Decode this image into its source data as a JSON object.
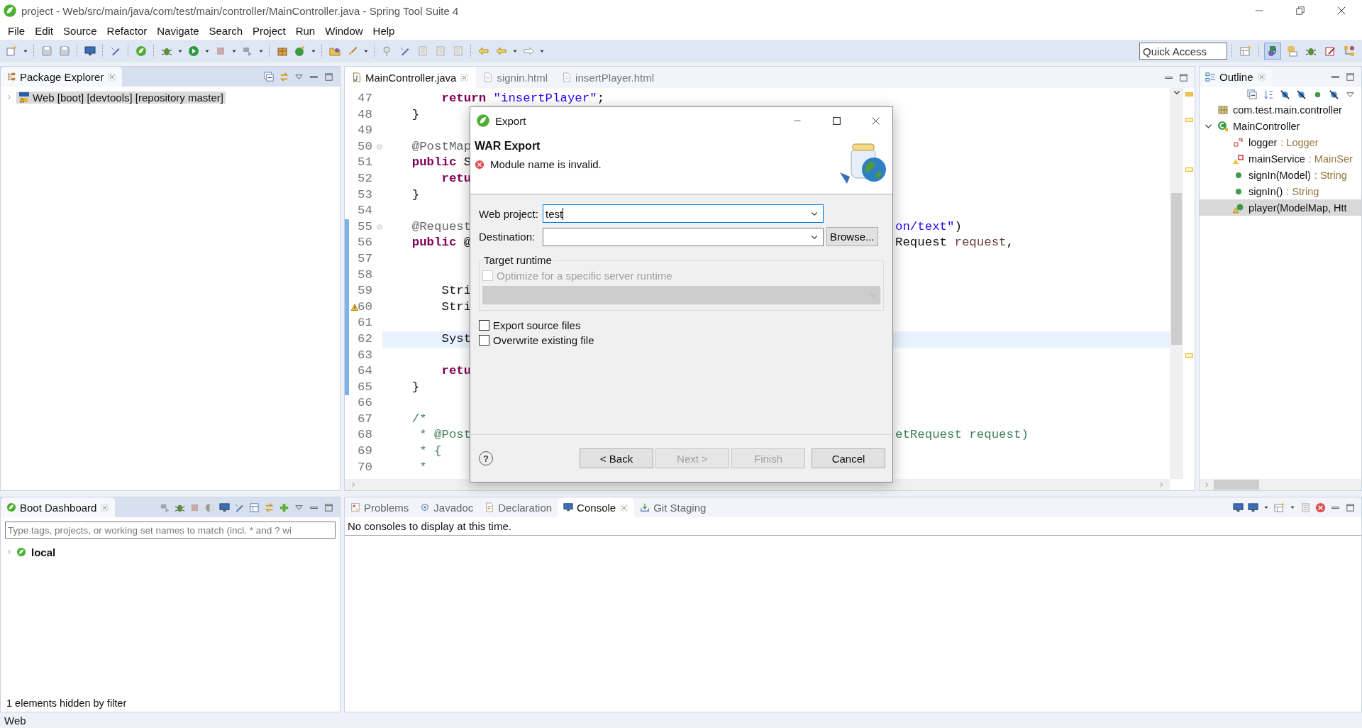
{
  "window": {
    "title": "project - Web/src/main/java/com/test/main/controller/MainController.java - Spring Tool Suite 4"
  },
  "menu": [
    "File",
    "Edit",
    "Source",
    "Refactor",
    "Navigate",
    "Search",
    "Project",
    "Run",
    "Window",
    "Help"
  ],
  "quick_access": {
    "placeholder": "Quick Access"
  },
  "package_explorer": {
    "tab": "Package Explorer",
    "items": [
      {
        "label": "Web [boot] [devtools] [repository master]",
        "selected": true,
        "expanded": false
      }
    ]
  },
  "boot_dashboard": {
    "tab": "Boot Dashboard",
    "filter": {
      "placeholder": "Type tags, projects, or working set names to match (incl. * and ? wi"
    },
    "items": [
      {
        "label": "local",
        "expanded": false
      }
    ],
    "status": "1 elements hidden by filter"
  },
  "editor": {
    "tabs": [
      {
        "label": "MainController.java",
        "selected": true
      },
      {
        "label": "signin.html",
        "selected": false
      },
      {
        "label": "insertPlayer.html",
        "selected": false
      }
    ],
    "lines": [
      {
        "number": "47",
        "fold": false,
        "changed": false,
        "warning": false,
        "current": false,
        "left": [
          {
            "kind": "keyword",
            "text": "        return"
          },
          {
            "kind": "string",
            "text": " \"insertPlayer\""
          },
          {
            "kind": "plain",
            "text": ";"
          }
        ]
      },
      {
        "number": "48",
        "fold": false,
        "changed": false,
        "warning": false,
        "current": false,
        "left": [
          {
            "kind": "plain",
            "text": "    }"
          }
        ]
      },
      {
        "number": "49",
        "fold": false,
        "changed": false,
        "warning": false,
        "current": false
      },
      {
        "number": "50",
        "fold": true,
        "changed": false,
        "warning": false,
        "current": false,
        "left": [
          {
            "kind": "annotation",
            "text": "    @PostMap"
          }
        ]
      },
      {
        "number": "51",
        "fold": false,
        "changed": false,
        "warning": false,
        "current": false,
        "left": [
          {
            "kind": "keyword",
            "text": "    public"
          },
          {
            "kind": "plain",
            "text": " S"
          }
        ]
      },
      {
        "number": "52",
        "fold": false,
        "changed": false,
        "warning": false,
        "current": false,
        "left": [
          {
            "kind": "keyword",
            "text": "        retu"
          }
        ]
      },
      {
        "number": "53",
        "fold": false,
        "changed": false,
        "warning": false,
        "current": false,
        "left": [
          {
            "kind": "plain",
            "text": "    }"
          }
        ]
      },
      {
        "number": "54",
        "fold": false,
        "changed": false,
        "warning": false,
        "current": false
      },
      {
        "number": "55",
        "fold": true,
        "changed": true,
        "warning": false,
        "current": false,
        "left": [
          {
            "kind": "annotation",
            "text": "    @Request"
          }
        ],
        "right": [
          {
            "kind": "string",
            "text": "on/text\""
          },
          {
            "kind": "plain",
            "text": ")"
          }
        ]
      },
      {
        "number": "56",
        "fold": false,
        "changed": true,
        "warning": false,
        "current": false,
        "left": [
          {
            "kind": "keyword",
            "text": "    public"
          },
          {
            "kind": "plain",
            "text": " @"
          }
        ],
        "right": [
          {
            "kind": "plain",
            "text": "Request "
          },
          {
            "kind": "param",
            "text": "request"
          },
          {
            "kind": "plain",
            "text": ","
          }
        ]
      },
      {
        "number": "57",
        "fold": false,
        "changed": true,
        "warning": false,
        "current": false
      },
      {
        "number": "58",
        "fold": false,
        "changed": true,
        "warning": false,
        "current": false
      },
      {
        "number": "59",
        "fold": false,
        "changed": true,
        "warning": false,
        "current": false,
        "left": [
          {
            "kind": "plain",
            "text": "        Stri"
          }
        ]
      },
      {
        "number": "60",
        "fold": false,
        "changed": true,
        "warning": true,
        "current": false,
        "left": [
          {
            "kind": "plain",
            "text": "        Stri"
          }
        ]
      },
      {
        "number": "61",
        "fold": false,
        "changed": true,
        "warning": false,
        "current": false
      },
      {
        "number": "62",
        "fold": false,
        "changed": true,
        "warning": false,
        "current": true,
        "left": [
          {
            "kind": "plain",
            "text": "        Syst"
          }
        ]
      },
      {
        "number": "63",
        "fold": false,
        "changed": true,
        "warning": false,
        "current": false
      },
      {
        "number": "64",
        "fold": false,
        "changed": true,
        "warning": false,
        "current": false,
        "left": [
          {
            "kind": "keyword",
            "text": "        retu"
          }
        ]
      },
      {
        "number": "65",
        "fold": false,
        "changed": true,
        "warning": false,
        "current": false,
        "left": [
          {
            "kind": "plain",
            "text": "    }"
          }
        ]
      },
      {
        "number": "66",
        "fold": false,
        "changed": false,
        "warning": false,
        "current": false
      },
      {
        "number": "67",
        "fold": false,
        "changed": false,
        "warning": false,
        "current": false,
        "left": [
          {
            "kind": "comment",
            "text": "    /*"
          }
        ]
      },
      {
        "number": "68",
        "fold": false,
        "changed": false,
        "warning": false,
        "current": false,
        "left": [
          {
            "kind": "comment",
            "text": "     * @Post"
          }
        ],
        "right": [
          {
            "kind": "comment",
            "text": "etRequest request)"
          }
        ]
      },
      {
        "number": "69",
        "fold": false,
        "changed": false,
        "warning": false,
        "current": false,
        "left": [
          {
            "kind": "comment",
            "text": "     * {"
          }
        ]
      },
      {
        "number": "70",
        "fold": false,
        "changed": false,
        "warning": false,
        "current": false,
        "left": [
          {
            "kind": "comment",
            "text": "     *"
          }
        ]
      }
    ]
  },
  "outline": {
    "tab": "Outline",
    "items": [
      {
        "label": "com.test.main.controller",
        "kind": "package",
        "selected": false
      },
      {
        "label": "MainController",
        "kind": "class",
        "selected": false,
        "expanded": true,
        "children": [
          {
            "label": "logger",
            "type": ": Logger",
            "kind": "static-field",
            "selected": false
          },
          {
            "label": "mainService",
            "type": ": MainSer",
            "kind": "field",
            "selected": false
          },
          {
            "label": "signIn(Model)",
            "type": ": String",
            "kind": "method",
            "selected": false
          },
          {
            "label": "signIn()",
            "type": ": String",
            "kind": "method",
            "selected": false
          },
          {
            "label": "player(ModelMap, Htt",
            "kind": "warning-method",
            "selected": true
          }
        ]
      }
    ]
  },
  "console": {
    "tabs": [
      {
        "label": "Problems",
        "kind": "problems",
        "selected": false
      },
      {
        "label": "Javadoc",
        "kind": "javadoc",
        "selected": false
      },
      {
        "label": "Declaration",
        "kind": "declaration",
        "selected": false
      },
      {
        "label": "Console",
        "kind": "console",
        "selected": true
      },
      {
        "label": "Git Staging",
        "kind": "git",
        "selected": false
      }
    ],
    "message": "No consoles to display at this time."
  },
  "status_bar": {
    "text": "Web"
  },
  "dialog": {
    "title": "Export",
    "heading": "WAR Export",
    "message": {
      "text": "Module name is invalid.",
      "kind": "error"
    },
    "web_project": {
      "label": "Web project:",
      "value": "test",
      "focused": true
    },
    "destination": {
      "label": "Destination:",
      "focused": false,
      "browse_button": "Browse..."
    },
    "target_runtime": {
      "title": "Target runtime",
      "optimize": {
        "label": "Optimize for a specific server runtime",
        "checked": false,
        "disabled": true
      }
    },
    "options": [
      {
        "label": "Export source files",
        "checked": false
      },
      {
        "label": "Overwrite existing file",
        "checked": false
      }
    ],
    "help": "?",
    "buttons": [
      {
        "label": "< Back",
        "disabled": false
      },
      {
        "label": "Next >",
        "disabled": true
      },
      {
        "label": "Finish",
        "disabled": true
      },
      {
        "label": "Cancel",
        "disabled": false
      }
    ]
  }
}
